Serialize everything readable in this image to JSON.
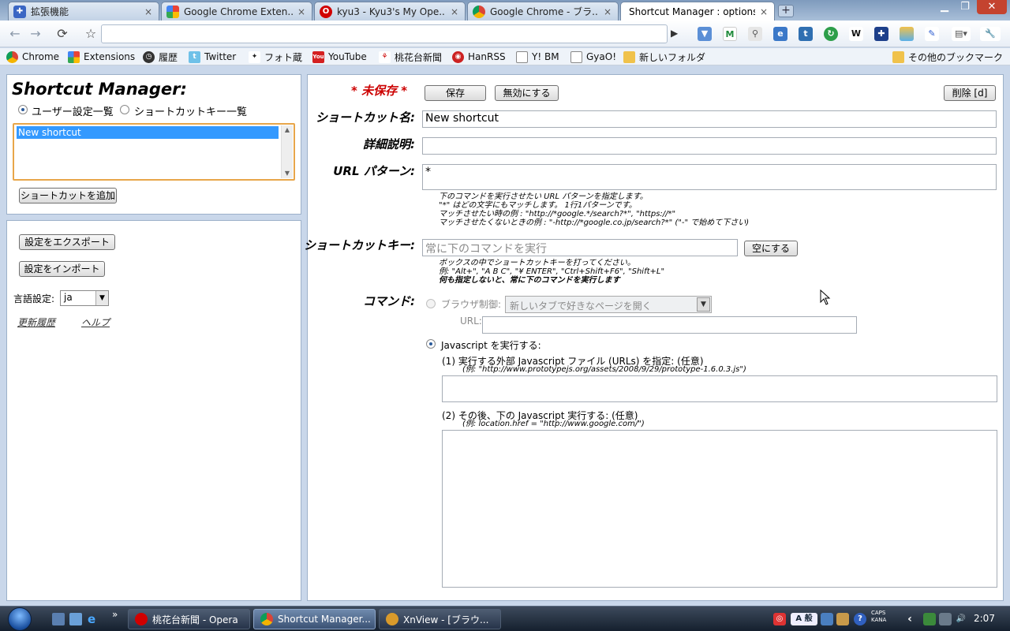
{
  "tabs": [
    {
      "title": "拡張機能",
      "icon": "puzzle-icon"
    },
    {
      "title": "Google Chrome Exten...",
      "icon": "google-icon"
    },
    {
      "title": "kyu3 - Kyu3's My Ope...",
      "icon": "opera-icon"
    },
    {
      "title": "Google Chrome - ブラ...",
      "icon": "chrome-icon"
    },
    {
      "title": "Shortcut Manager : options",
      "icon": "none"
    }
  ],
  "omnibox": {
    "value": ""
  },
  "bookmarks": [
    {
      "label": "Chrome",
      "icon": "chrome-icon"
    },
    {
      "label": "Extensions",
      "icon": "google-icon"
    },
    {
      "label": "履歴",
      "icon": "clock-icon"
    },
    {
      "label": "Twitter",
      "icon": "twitter-icon"
    },
    {
      "label": "フォト蔵",
      "icon": "photozou-icon"
    },
    {
      "label": "YouTube",
      "icon": "youtube-icon"
    },
    {
      "label": "桃花台新聞",
      "icon": "news-icon"
    },
    {
      "label": "HanRSS",
      "icon": "rss-icon"
    },
    {
      "label": "Y! BM",
      "icon": "page-icon"
    },
    {
      "label": "GyaO!",
      "icon": "page-icon"
    },
    {
      "label": "新しいフォルダ",
      "icon": "folder-icon"
    }
  ],
  "other_bookmarks": "その他のブックマーク",
  "sidebar": {
    "title": "Shortcut Manager:",
    "view_options": [
      "ユーザー設定一覧",
      "ショートカットキー一覧"
    ],
    "shortcuts": [
      "New shortcut"
    ],
    "add_button": "ショートカットを追加",
    "export_button": "設定をエクスポート",
    "import_button": "設定をインポート",
    "language_label": "言語設定:",
    "language_value": "ja",
    "history_link": "更新履歴",
    "help_link": "ヘルプ"
  },
  "editor": {
    "unsaved": "* 未保存 *",
    "save_button": "保存",
    "disable_button": "無効にする",
    "delete_button": "削除 [d]",
    "name_label": "ショートカット名:",
    "name_value": "New shortcut",
    "desc_label": "詳細説明:",
    "desc_value": "",
    "url_label": "URL パターン:",
    "url_value": "*",
    "url_hints": [
      "下のコマンドを実行させたい URL パターンを指定します。",
      "\"*\" はどの文字にもマッチします。 1行1パターンです。",
      "マッチさせたい時の例 : \"http://*google.*/search?*\", \"https://*\"",
      "マッチさせたくないときの例 : \"-http://*google.co.jp/search?*\" (\"-\" で始めて下さい)"
    ],
    "key_label": "ショートカットキー:",
    "key_placeholder": "常に下のコマンドを実行",
    "clear_button": "空にする",
    "key_hints": [
      "ボックスの中でショートカットキーを打ってください。",
      "例: \"Alt+\", \"A B C\", \"¥ ENTER\", \"Ctrl+Shift+F6\", \"Shift+L\""
    ],
    "key_hint_bold": "何も指定しないと、常に下のコマンドを実行します",
    "command_label": "コマンド:",
    "browser_option": "ブラウザ制御:",
    "browser_select": "新しいタブで好きなページを開く",
    "url_field_label": "URL:",
    "js_option": "Javascript を実行する:",
    "js_step1": "(1) 実行する外部 Javascript ファイル (URLs) を指定: (任意)",
    "js_step1_example": "(例: \"http://www.prototypejs.org/assets/2008/9/29/prototype-1.6.0.3.js\")",
    "js_step2": "(2) その後、下の Javascript 実行する: (任意)",
    "js_step2_example": "(例: location.href = \"http://www.google.com/\")"
  },
  "taskbar": {
    "tasks": [
      {
        "label": "桃花台新聞 - Opera",
        "icon": "opera-icon"
      },
      {
        "label": "Shortcut Manager...",
        "icon": "chrome-icon"
      },
      {
        "label": "XnView - [ブラウ...",
        "icon": "xnview-icon"
      }
    ],
    "ime": "A 般",
    "caps": "CAPS",
    "kana": "KANA",
    "clock": "2:07"
  },
  "colors": {
    "unsaved": "#cc0000",
    "selection": "#3399ff",
    "list_border": "#e8a64a"
  }
}
